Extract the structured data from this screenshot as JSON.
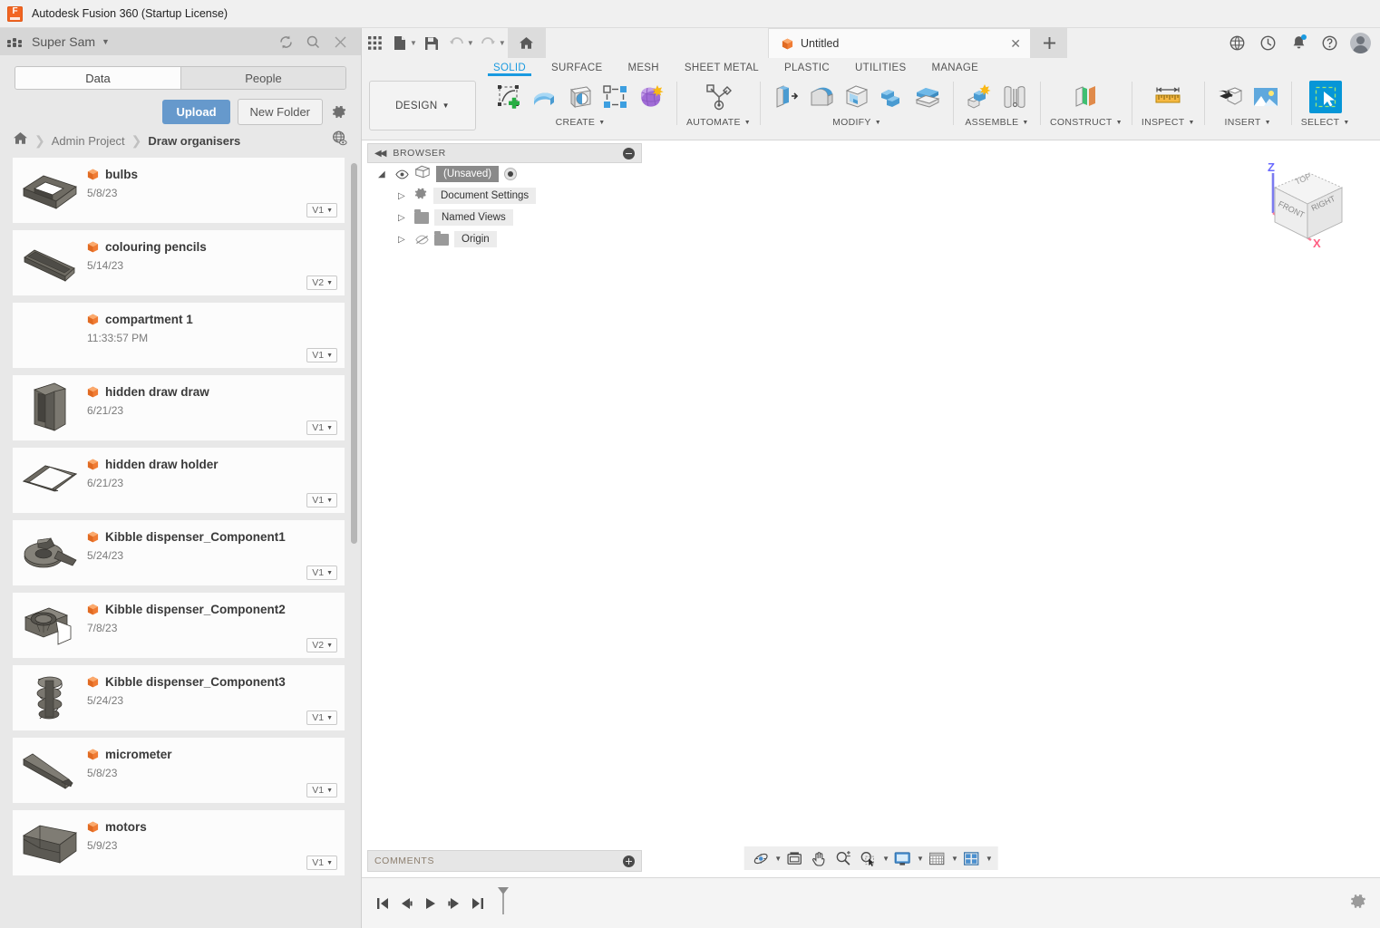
{
  "window": {
    "title": "Autodesk Fusion 360 (Startup License)",
    "app_icon": "fusion-logo-icon"
  },
  "data_panel": {
    "hub_name": "Super Sam",
    "header_icons": [
      "refresh-icon",
      "search-icon",
      "close-icon"
    ],
    "tabs": [
      {
        "label": "Data",
        "active": true
      },
      {
        "label": "People",
        "active": false
      }
    ],
    "actions": {
      "upload_label": "Upload",
      "new_folder_label": "New Folder",
      "settings_icon": "gear-icon"
    },
    "breadcrumb": {
      "home_icon": "home-icon",
      "items": [
        "Admin Project",
        "Draw organisers"
      ],
      "globe_icon": "globe-eye-icon"
    },
    "files": [
      {
        "name": "bulbs",
        "date": "5/8/23",
        "version": "V1",
        "thumb": "open-box"
      },
      {
        "name": "colouring pencils",
        "date": "5/14/23",
        "version": "V2",
        "thumb": "long-tray"
      },
      {
        "name": "compartment 1",
        "date": "11:33:57 PM",
        "version": "V1",
        "thumb": "none"
      },
      {
        "name": "hidden draw draw",
        "date": "6/21/23",
        "version": "V1",
        "thumb": "tall-frame"
      },
      {
        "name": "hidden draw holder",
        "date": "6/21/23",
        "version": "V1",
        "thumb": "flat-u-frame"
      },
      {
        "name": "Kibble dispenser_Component1",
        "date": "5/24/23",
        "version": "V1",
        "thumb": "dispenser-base"
      },
      {
        "name": "Kibble dispenser_Component2",
        "date": "7/8/23",
        "version": "V2",
        "thumb": "dispenser-hopper"
      },
      {
        "name": "Kibble dispenser_Component3",
        "date": "5/24/23",
        "version": "V1",
        "thumb": "auger-screw"
      },
      {
        "name": "micrometer",
        "date": "5/8/23",
        "version": "V1",
        "thumb": "angled-bar"
      },
      {
        "name": "motors",
        "date": "5/9/23",
        "version": "V1",
        "thumb": "box-divider"
      }
    ],
    "scrollbar": "vertical-scrollbar"
  },
  "quick_access": {
    "buttons": [
      {
        "icon": "grid-apps-icon",
        "label": ""
      },
      {
        "icon": "new-file-icon",
        "label": ""
      },
      {
        "icon": "save-icon",
        "label": ""
      },
      {
        "icon": "undo-icon",
        "label": ""
      },
      {
        "icon": "redo-icon",
        "label": ""
      },
      {
        "icon": "home-icon",
        "label": ""
      }
    ],
    "document_tab": {
      "title": "Untitled",
      "icon": "orange-cube-icon",
      "close_icon": "close-icon"
    },
    "new_tab_icon": "plus-icon",
    "right_icons": [
      "globe-icon",
      "job-status-icon",
      "notifications-bell-icon",
      "help-icon",
      "user-avatar"
    ]
  },
  "ribbon": {
    "workspace_label": "DESIGN",
    "tabs": [
      {
        "label": "SOLID",
        "active": true
      },
      {
        "label": "SURFACE",
        "active": false
      },
      {
        "label": "MESH",
        "active": false
      },
      {
        "label": "SHEET METAL",
        "active": false
      },
      {
        "label": "PLASTIC",
        "active": false
      },
      {
        "label": "UTILITIES",
        "active": false
      },
      {
        "label": "MANAGE",
        "active": false
      }
    ],
    "groups": [
      {
        "name": "CREATE",
        "icons": [
          "create-sketch-icon",
          "extrude-icon",
          "revolve-icon",
          "pattern-icon",
          "form-icon"
        ]
      },
      {
        "name": "AUTOMATE",
        "icons": [
          "automate-icon"
        ]
      },
      {
        "name": "MODIFY",
        "icons": [
          "press-pull-icon",
          "fillet-icon",
          "shell-icon",
          "combine-icon",
          "offset-face-icon"
        ]
      },
      {
        "name": "ASSEMBLE",
        "icons": [
          "new-component-icon",
          "joint-icon"
        ]
      },
      {
        "name": "CONSTRUCT",
        "icons": [
          "construct-plane-icon"
        ]
      },
      {
        "name": "INSPECT",
        "icons": [
          "measure-icon"
        ]
      },
      {
        "name": "INSERT",
        "icons": [
          "insert-derive-icon",
          "insert-image-icon"
        ]
      },
      {
        "name": "SELECT",
        "icons": [
          "select-window-icon"
        ]
      }
    ]
  },
  "browser": {
    "title": "BROWSER",
    "collapse_icon": "collapse-left-icon",
    "minimize_icon": "minus-circle-icon",
    "nodes": [
      {
        "label": "(Unsaved)",
        "level": 0,
        "icon": "body-cube-icon",
        "has_eye": true,
        "has_radio": true
      },
      {
        "label": "Document Settings",
        "level": 1,
        "icon": "gear-icon",
        "has_eye": false,
        "has_radio": false
      },
      {
        "label": "Named Views",
        "level": 1,
        "icon": "folder-icon",
        "has_eye": false,
        "has_radio": false
      },
      {
        "label": "Origin",
        "level": 1,
        "icon": "folder-icon",
        "has_eye": true,
        "has_radio": false
      }
    ]
  },
  "view_cube": {
    "faces": [
      "TOP",
      "FRONT",
      "RIGHT"
    ],
    "axes": [
      "Z",
      "X"
    ],
    "axis_colors": {
      "z": "#6a6aff",
      "x": "#ff6a8a"
    }
  },
  "comments": {
    "title": "COMMENTS",
    "add_icon": "plus-circle-icon"
  },
  "nav_bar": {
    "icons": [
      "orbit-icon",
      "look-at-icon",
      "pan-icon",
      "zoom-icon",
      "zoom-window-icon",
      "display-settings-icon",
      "grid-snaps-icon",
      "viewports-icon"
    ]
  },
  "timeline": {
    "buttons": [
      "go-to-beginning-icon",
      "step-back-icon",
      "play-icon",
      "step-forward-icon",
      "go-to-end-icon"
    ],
    "marker_icon": "timeline-marker-icon",
    "settings_icon": "gear-icon"
  },
  "colors": {
    "accent_blue": "#1a9ae0",
    "upload_blue": "#6699cc",
    "brand_orange": "#f26522",
    "panel_bg": "#e8e8e8",
    "ribbon_bg": "#f0f0f0",
    "canvas_bg": "#ffffff"
  }
}
